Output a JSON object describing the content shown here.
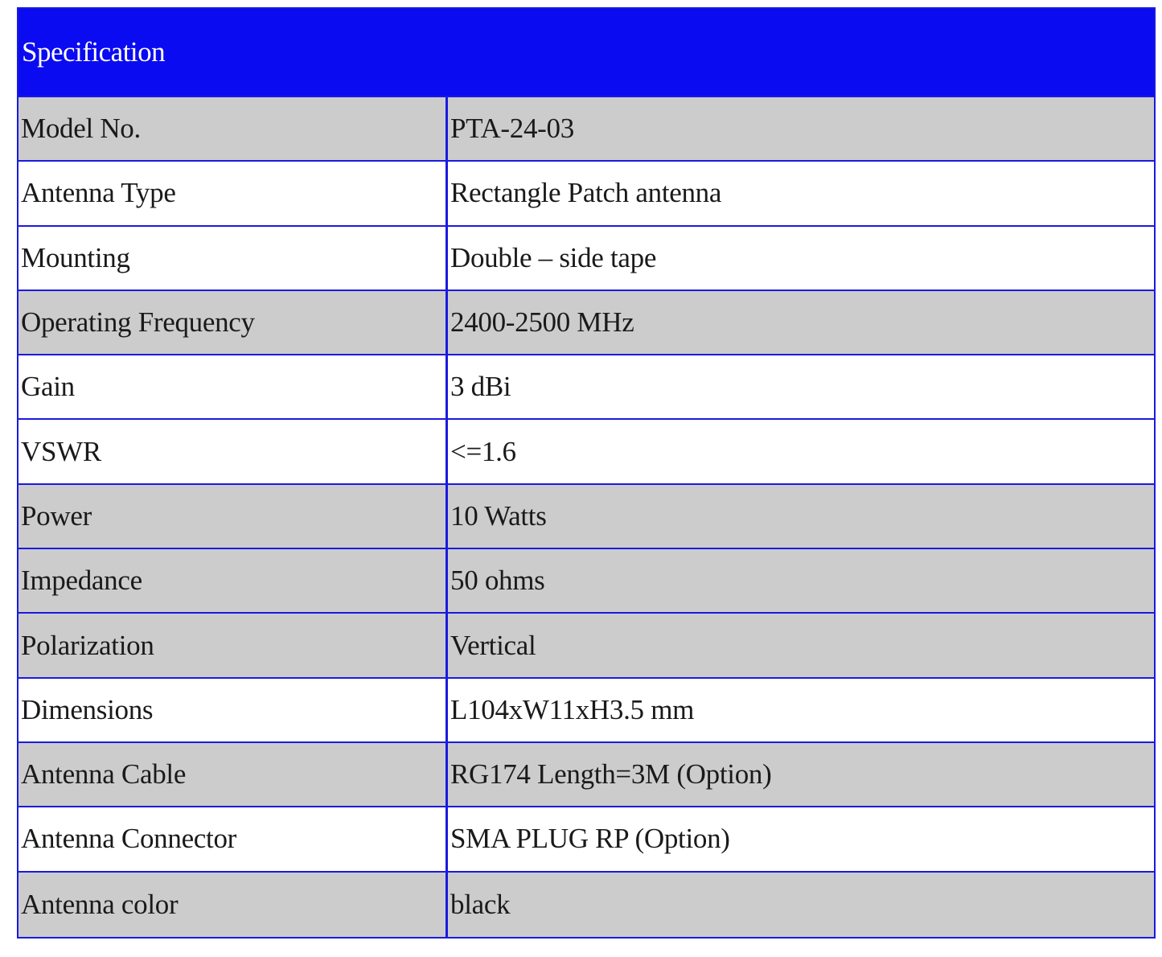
{
  "table": {
    "header": "Specification",
    "rows": [
      {
        "label": "Model No.",
        "value": "PTA-24-03",
        "shade": "shaded"
      },
      {
        "label": "Antenna Type",
        "value": "Rectangle Patch antenna",
        "shade": "plain"
      },
      {
        "label": "Mounting",
        "value": "Double – side tape",
        "shade": "plain"
      },
      {
        "label": "Operating Frequency",
        "value": "2400-2500 MHz",
        "shade": "shaded"
      },
      {
        "label": "Gain",
        "value": "3 dBi",
        "shade": "plain"
      },
      {
        "label": "VSWR",
        "value": "<=1.6",
        "shade": "plain"
      },
      {
        "label": "Power",
        "value": "10 Watts",
        "shade": "shaded"
      },
      {
        "label": "Impedance",
        "value": "50 ohms",
        "shade": "shaded"
      },
      {
        "label": "Polarization",
        "value": "Vertical",
        "shade": "shaded"
      },
      {
        "label": "Dimensions",
        "value": "L104xW11xH3.5 mm",
        "shade": "plain"
      },
      {
        "label": "Antenna Cable",
        "value": "RG174 Length=3M (Option)",
        "shade": "shaded"
      },
      {
        "label": "Antenna Connector",
        "value": "SMA PLUG RP (Option)",
        "shade": "plain"
      },
      {
        "label": "Antenna color",
        "value": "black",
        "shade": "shaded"
      }
    ]
  },
  "colors": {
    "header_background": "#0b0bf2",
    "border": "#1a1adf",
    "shaded_row": "#cccccc",
    "plain_row": "#ffffff"
  }
}
